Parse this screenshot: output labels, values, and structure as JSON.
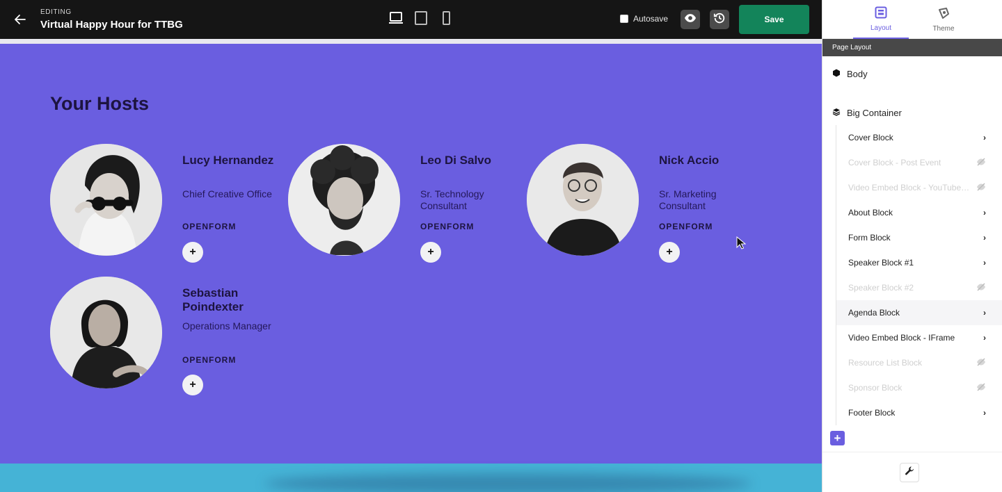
{
  "topbar": {
    "editing_label": "EDITING",
    "title": "Virtual Happy Hour for TTBG",
    "autosave_label": "Autosave",
    "save_label": "Save"
  },
  "canvas": {
    "section_title": "Your Hosts",
    "hosts": [
      {
        "name": "Lucy Hernandez",
        "role": "Chief Creative Office",
        "org": "OPENFORM",
        "plus": "+"
      },
      {
        "name": "Leo Di Salvo",
        "role": "Sr. Technology Consultant",
        "org": "OPENFORM",
        "plus": "+"
      },
      {
        "name": "Nick Accio",
        "role": "Sr. Marketing Consultant",
        "org": "OPENFORM",
        "plus": "+"
      },
      {
        "name": "Sebastian Poindexter",
        "role": "Operations Manager",
        "org": "OPENFORM",
        "plus": "+"
      }
    ]
  },
  "panel": {
    "tabs": {
      "layout": "Layout",
      "theme": "Theme"
    },
    "header": "Page Layout",
    "body_label": "Body",
    "big_container_label": "Big Container",
    "blocks": [
      {
        "label": "Cover Block",
        "state": "visible"
      },
      {
        "label": "Cover Block - Post Event",
        "state": "hidden"
      },
      {
        "label": "Video Embed Block - YouTube/...",
        "state": "hidden"
      },
      {
        "label": "About Block",
        "state": "visible"
      },
      {
        "label": "Form Block",
        "state": "visible"
      },
      {
        "label": "Speaker Block #1",
        "state": "visible"
      },
      {
        "label": "Speaker Block #2",
        "state": "hidden"
      },
      {
        "label": "Agenda Block",
        "state": "visible"
      },
      {
        "label": "Video Embed Block - IFrame",
        "state": "visible"
      },
      {
        "label": "Resource List Block",
        "state": "hidden"
      },
      {
        "label": "Sponsor Block",
        "state": "hidden"
      },
      {
        "label": "Footer Block",
        "state": "visible"
      }
    ],
    "add_label": "+"
  },
  "colors": {
    "canvas_bg": "#6a5ee0",
    "accent": "#6a5ee0",
    "save_green": "#13845a",
    "footer_section": "#45b3d6"
  },
  "icons": [
    "back-arrow-icon",
    "desktop-icon",
    "tablet-icon",
    "mobile-icon",
    "eye-icon",
    "history-icon",
    "layout-icon",
    "theme-icon",
    "body-hexagon-icon",
    "layers-icon",
    "chevron-right-icon",
    "hidden-eye-icon",
    "plus-icon",
    "wrench-icon",
    "mouse-cursor-icon"
  ]
}
